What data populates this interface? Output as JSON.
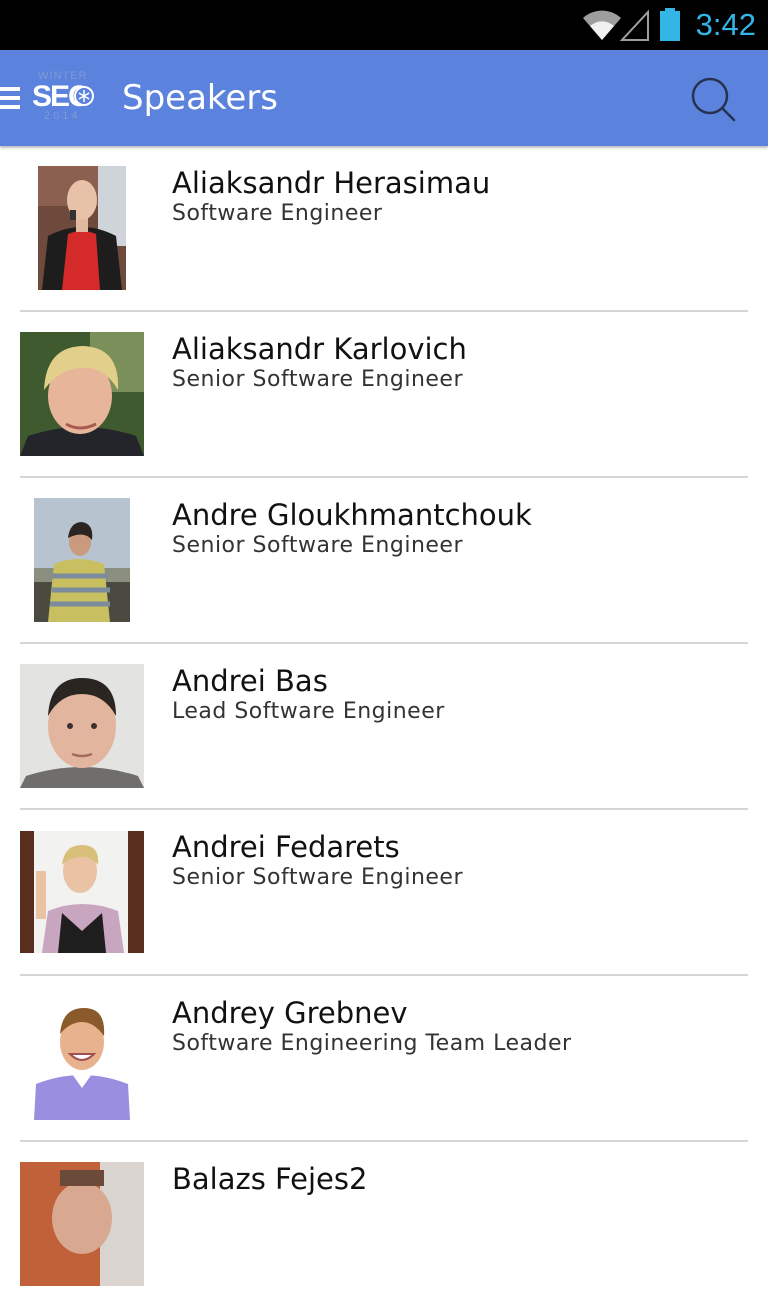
{
  "status_bar": {
    "time": "3:42",
    "icons": [
      "wifi-icon",
      "cell-signal-icon",
      "battery-icon"
    ],
    "accent": "#33b5e5"
  },
  "app_bar": {
    "title": "Speakers",
    "background": "#5b82dc",
    "logo": {
      "top": "WINTER",
      "main": "SEC",
      "bottom": "2014"
    },
    "icons": [
      "drawer-menu-icon",
      "search-icon"
    ]
  },
  "speakers": [
    {
      "name": "Aliaksandr Herasimau",
      "role": "Software Engineer"
    },
    {
      "name": "Aliaksandr Karlovich",
      "role": "Senior Software Engineer"
    },
    {
      "name": "Andre Gloukhmantchouk",
      "role": "Senior Software Engineer"
    },
    {
      "name": "Andrei Bas",
      "role": "Lead Software Engineer"
    },
    {
      "name": "Andrei Fedarets",
      "role": "Senior Software Engineer"
    },
    {
      "name": "Andrey Grebnev",
      "role": "Software Engineering Team Leader"
    },
    {
      "name": "Balazs Fejes2",
      "role": ""
    }
  ]
}
